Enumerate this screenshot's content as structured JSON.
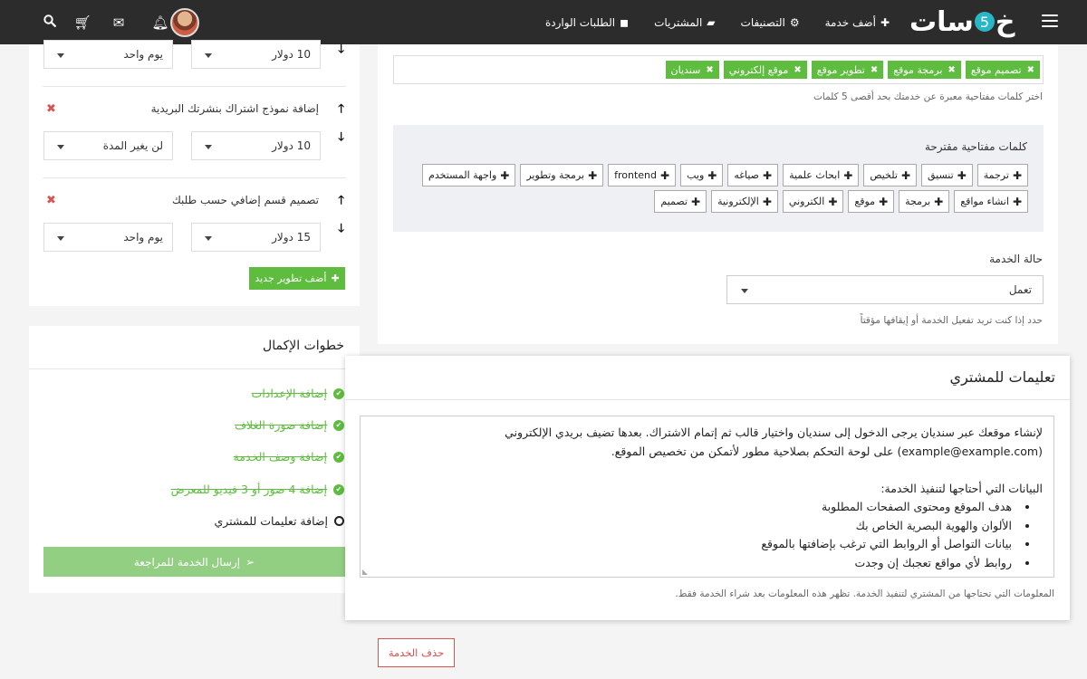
{
  "navbar": {
    "logo": {
      "pre": "خ",
      "five": "5",
      "post": "سات"
    },
    "links": [
      {
        "icon": "✚",
        "label": "أضف خدمة"
      },
      {
        "icon": "⚙",
        "label": "التصنيفات"
      },
      {
        "icon": "▰",
        "label": "المشتريات"
      },
      {
        "icon": "◼",
        "label": "الطلبات الواردة"
      }
    ]
  },
  "keywords": {
    "tags": [
      "تصميم موقع",
      "برمجة موقع",
      "تطوير موقع",
      "موقع إلكتروني",
      "سنديان"
    ],
    "help": "اختر كلمات مفتاحية معبرة عن خدمتك بحد أقصى 5 كلمات"
  },
  "suggested": {
    "title": "كلمات مفتاحية مقترحة",
    "row1": [
      "ترجمة",
      "تنسيق",
      "تلخيص",
      "ابحاث علمية",
      "صياغه",
      "ويب",
      "frontend",
      "برمجة وتطوير",
      "واجهة المستخدم"
    ],
    "row2": [
      "انشاء مواقع",
      "برمجة",
      "موقع",
      "الكتروني",
      "الإلكترونية",
      "تصميم"
    ]
  },
  "service_status": {
    "label": "حالة الخدمة",
    "value": "تعمل",
    "help": "حدد إذا كنت تريد تفعيل الخدمة أو إيقافها مؤقتاً"
  },
  "developments": [
    {
      "title": "",
      "price": "10 دولار",
      "duration": "يوم واحد"
    },
    {
      "title": "إضافة نموذج اشتراك بنشرتك البريدية",
      "price": "10 دولار",
      "duration": "لن يغير المدة"
    },
    {
      "title": "تصميم قسم إضافي حسب طلبك",
      "price": "15 دولار",
      "duration": "يوم واحد"
    }
  ],
  "add_dev_button": "أضف تطوير جديد",
  "steps": {
    "title": "خطوات الإكمال",
    "items": [
      {
        "label": "إضافة الإعدادات",
        "done": true
      },
      {
        "label": "إضافة صورة الغلاف",
        "done": true
      },
      {
        "label": "إضافة وصف الخدمة",
        "done": true
      },
      {
        "label": "إضافة 4 صور أو 3 فيديو للمعرض",
        "done": true
      },
      {
        "label": "إضافة تعليمات للمشتري",
        "done": false
      }
    ],
    "submit": "إرسال الخدمة للمراجعة"
  },
  "instructions": {
    "title": "تعليمات للمشتري",
    "line1": "لإنشاء موقعك عبر سنديان يرجى الدخول إلى سنديان واختيار قالب ثم إتمام الاشتراك. بعدها تضيف بريدي الإلكتروني",
    "line2": "(example@example.com) على لوحة التحكم بصلاحية مطور لأتمكن من تخصيص الموقع.",
    "data_heading": "البيانات التي أحتاجها لتنفيذ الخدمة:",
    "bullets": [
      "هدف الموقع ومحتوى الصفحات المطلوبة",
      "الألوان والهوية البصرية الخاص بك",
      "بيانات التواصل أو الروابط التي ترغب بإضافتها بالموقع",
      "روابط لأي مواقع تعجبك إن وجدت"
    ],
    "help": "المعلومات التي تحتاجها من المشتري لتنفيذ الخدمة. تظهر هذه المعلومات بعد شراء الخدمة فقط."
  },
  "delete_button": "حذف الخدمة"
}
